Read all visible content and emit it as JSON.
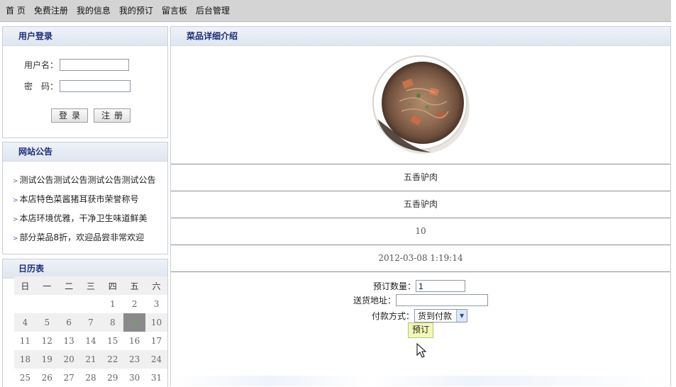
{
  "nav": {
    "items": [
      "首 页",
      "免费注册",
      "我的信息",
      "我的预订",
      "留言板",
      "后台管理"
    ]
  },
  "login": {
    "title": "用户登录",
    "username_label": "用户名：",
    "password_label": "密　码：",
    "login_button": "登录",
    "register_button": "注册"
  },
  "notice": {
    "title": "网站公告",
    "items": [
      "测试公告测试公告测试公告测试公告",
      "本店特色菜酱猪耳获市荣誉称号",
      "本店环境优雅，干净卫生味道鲜美",
      "部分菜品8折，欢迎品尝非常欢迎"
    ]
  },
  "calendar": {
    "title": "日历表",
    "weekdays": [
      "日",
      "一",
      "二",
      "三",
      "四",
      "五",
      "六"
    ],
    "weeks": [
      [
        "",
        "",
        "",
        "",
        "1",
        "2",
        "3"
      ],
      [
        "4",
        "5",
        "6",
        "7",
        "8",
        "9",
        "10"
      ],
      [
        "11",
        "12",
        "13",
        "14",
        "15",
        "16",
        "17"
      ],
      [
        "18",
        "19",
        "20",
        "21",
        "22",
        "23",
        "24"
      ],
      [
        "25",
        "26",
        "27",
        "28",
        "29",
        "30",
        "31"
      ]
    ],
    "today": "9"
  },
  "detail": {
    "title": "菜品详细介绍",
    "name": "五香驴肉",
    "description": "五香驴肉",
    "price": "10",
    "date": "2012-03-08 1:19:14",
    "quantity_label": "预订数量：",
    "quantity_value": "1",
    "address_label": "送货地址：",
    "address_value": "",
    "payment_label": "付款方式：",
    "payment_value": "货到付款",
    "order_button": "预订"
  },
  "colors": {
    "nav_bg": "#d4d4d4",
    "panel_title": "#1c2d78",
    "order_button_bg": "#f4f8b6"
  }
}
